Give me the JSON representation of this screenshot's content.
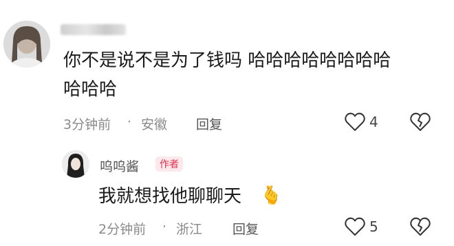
{
  "comment1": {
    "username_hint": "喵咪小喵",
    "text_line1": "你不是说不是为了钱吗 哈哈哈哈哈哈哈哈",
    "text_line2": "哈哈哈",
    "time": "3分钟前",
    "separator": "·",
    "location": "安徽",
    "reply_label": "回复",
    "like_count": "4"
  },
  "comment2": {
    "username": "呜呜酱",
    "author_tag": "作者",
    "text": "我就想找他聊聊天",
    "emoji": "🫰",
    "time": "2分钟前",
    "separator": "·",
    "location": "浙江",
    "reply_label": "回复",
    "like_count": "5"
  },
  "colors": {
    "accent": "#e0314b",
    "meta": "#8a8a8a",
    "text": "#1a1a1a"
  }
}
